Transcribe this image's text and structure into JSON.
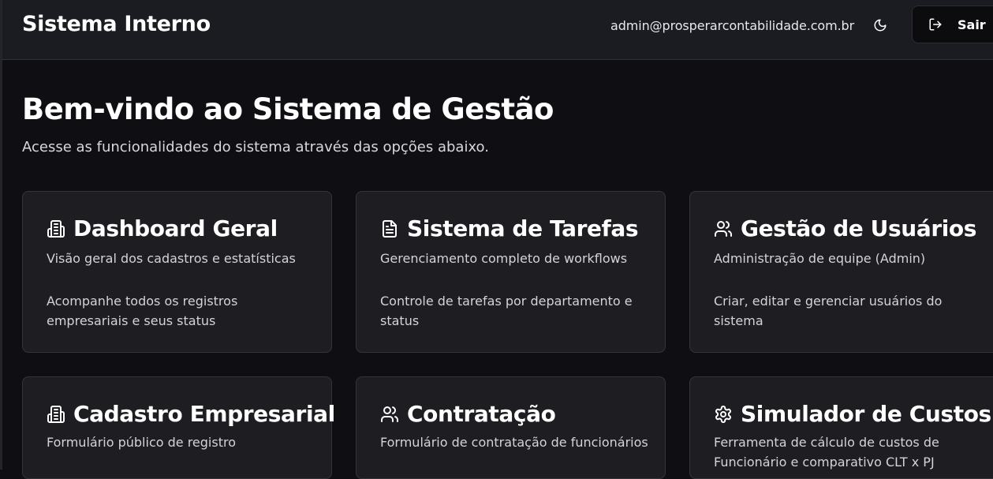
{
  "header": {
    "title": "Sistema Interno",
    "user_email": "admin@prosperarcontabilidade.com.br",
    "theme_icon": "moon-icon",
    "logout_label": "Sair",
    "logout_icon": "logout-icon"
  },
  "welcome": {
    "title": "Bem-vindo ao Sistema de Gestão",
    "subtitle": "Acesse as funcionalidades do sistema através das opções abaixo."
  },
  "cards": [
    {
      "icon": "building-icon",
      "title": "Dashboard Geral",
      "subtitle": "Visão geral dos cadastros e estatísticas",
      "body": "Acompanhe todos os registros empresariais e seus status"
    },
    {
      "icon": "document-icon",
      "title": "Sistema de Tarefas",
      "subtitle": "Gerenciamento completo de workflows",
      "body": "Controle de tarefas por departamento e status"
    },
    {
      "icon": "users-icon",
      "title": "Gestão de Usuários",
      "subtitle": "Administração de equipe (Admin)",
      "body": "Criar, editar e gerenciar usuários do sistema"
    },
    {
      "icon": "building-icon",
      "title": "Cadastro Empresarial",
      "subtitle": "Formulário público de registro",
      "body": ""
    },
    {
      "icon": "users-icon",
      "title": "Contratação",
      "subtitle": "Formulário de contratação de funcionários",
      "body": ""
    },
    {
      "icon": "gear-icon",
      "title": "Simulador de Custos",
      "subtitle": "Ferramenta de cálculo de custos de Funcionário e comparativo CLT x PJ",
      "body": ""
    }
  ]
}
